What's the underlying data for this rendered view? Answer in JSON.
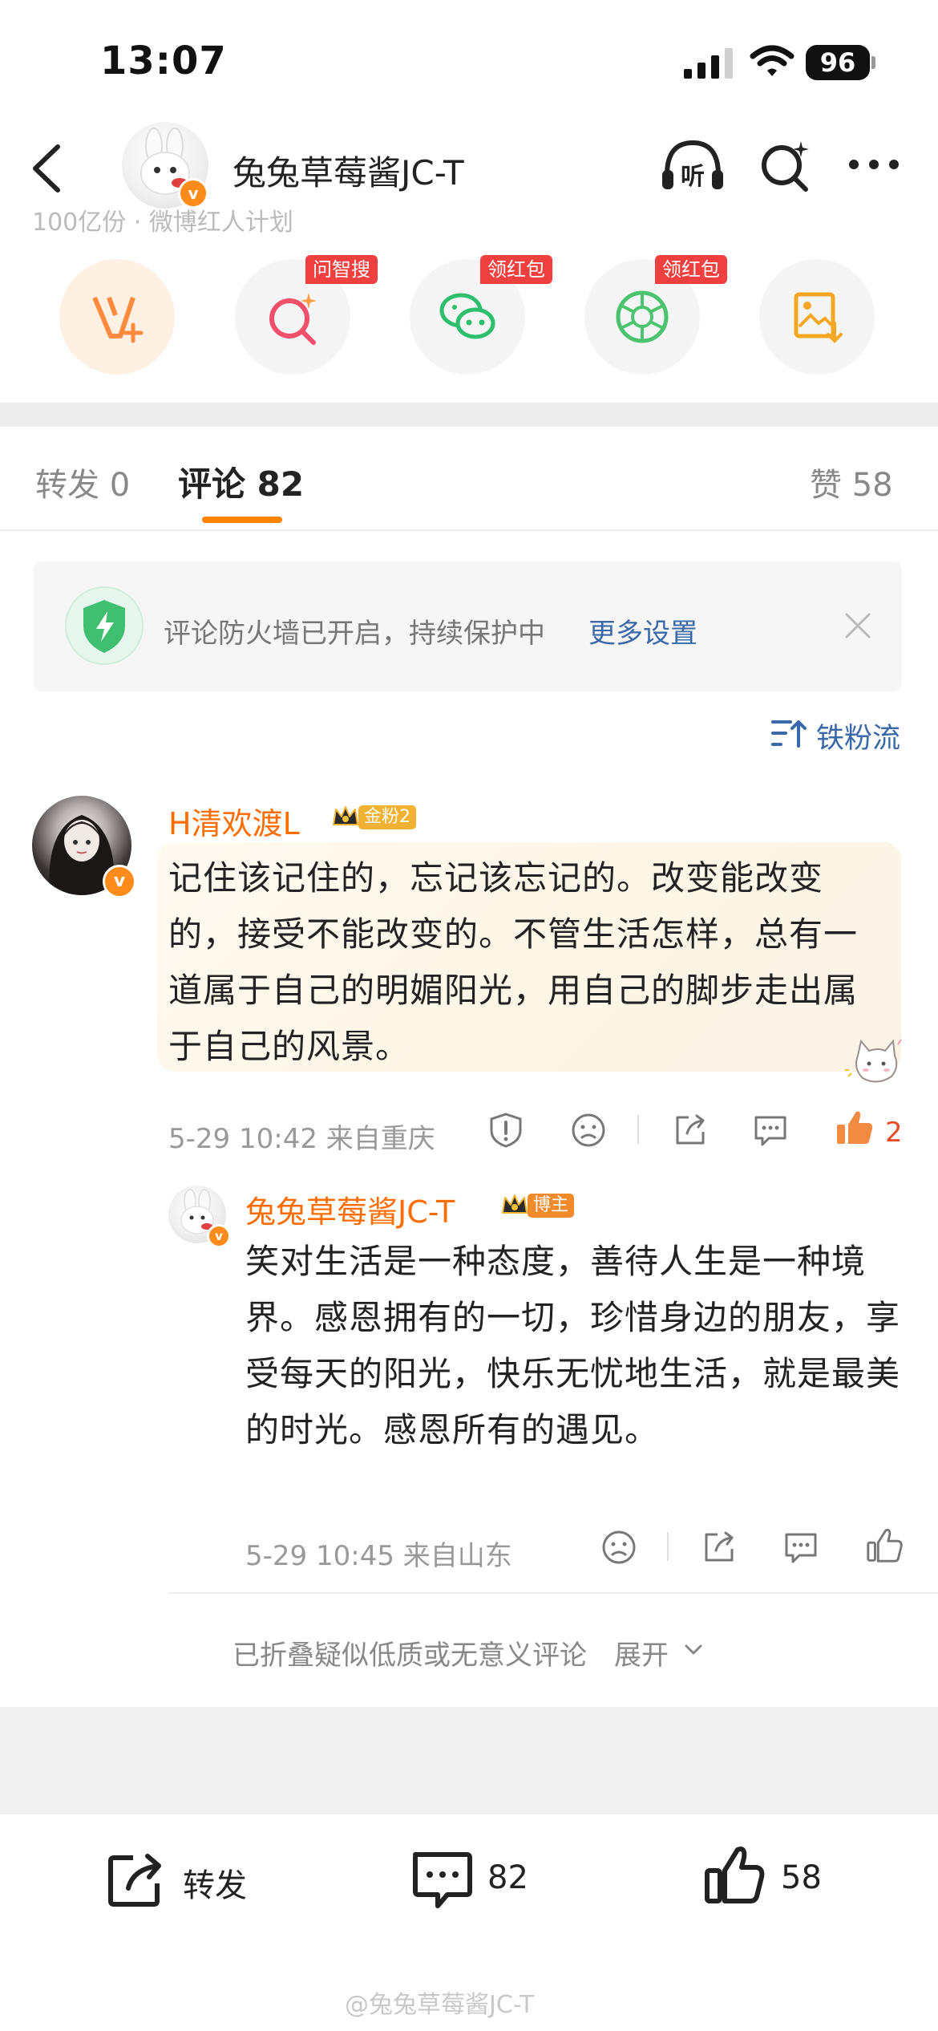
{
  "status_bar": {
    "time": "13:07",
    "battery": "96"
  },
  "header": {
    "name": "兔兔草莓酱JC-T",
    "faded_text": "100亿份 · 微博红人计划"
  },
  "tools": [
    {
      "name": "v-plus",
      "badge": ""
    },
    {
      "name": "ai-search",
      "badge": "问智搜"
    },
    {
      "name": "wechat",
      "badge": "领红包"
    },
    {
      "name": "moments",
      "badge": "领红包"
    },
    {
      "name": "save-image",
      "badge": ""
    }
  ],
  "tabs": {
    "repost": "转发 0",
    "comments": "评论 82",
    "likes": "赞 58"
  },
  "firewall": {
    "text": "评论防火墙已开启，持续保护中",
    "settings": "更多设置"
  },
  "sort": {
    "label": "铁粉流"
  },
  "comment1": {
    "author": "H清欢渡L",
    "badge": "金粉2",
    "text": "记住该记住的，忘记该忘记的。改变能改变的，接受不能改变的。不管生活怎样，总有一道属于自己的明媚阳光，用自己的脚步走出属于自己的风景。",
    "meta": "5-29 10:42  来自重庆",
    "likes": "2"
  },
  "reply1": {
    "author": "兔兔草莓酱JC-T",
    "badge": "博主",
    "text": "笑对生活是一种态度，善待人生是一种境界。感恩拥有的一切，珍惜身边的朋友，享受每天的阳光，快乐无忧地生活，就是最美的时光。感恩所有的遇见。",
    "meta": "5-29 10:45  来自山东"
  },
  "folded": {
    "text": "已折叠疑似低质或无意义评论",
    "expand": "展开"
  },
  "bottom_bar": {
    "repost": "转发",
    "comments": "82",
    "likes": "58"
  },
  "watermark": "@兔兔草莓酱JC-T",
  "colors": {
    "accent": "#ff8200",
    "link": "#3a68a8",
    "name": "#ff6d00",
    "badge_red": "#ef3f3f"
  }
}
